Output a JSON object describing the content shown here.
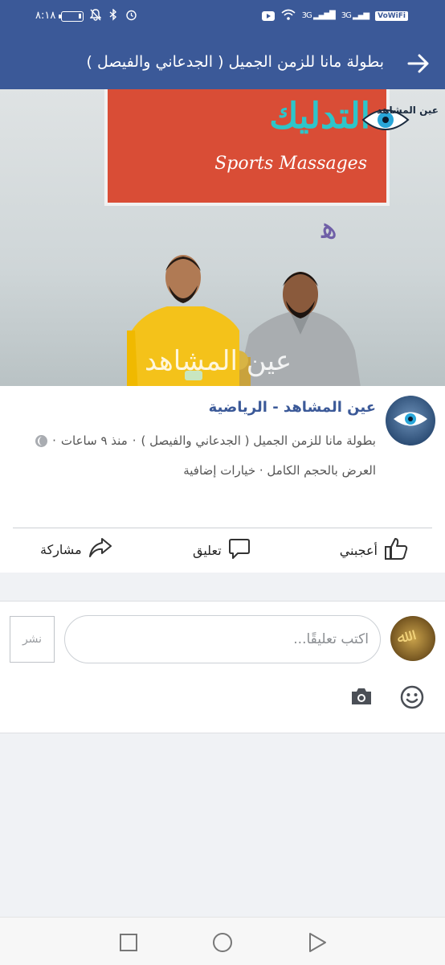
{
  "status_bar": {
    "time": "٨:١٨",
    "network_left": "3G",
    "network_right": "3G",
    "vowifi": "VoWiFi"
  },
  "header": {
    "title": "بطولة مانا للزمن الجميل ( الجدعاني والفيصل )",
    "back_icon": "arrow-right-icon",
    "background": "#3b5998"
  },
  "photo": {
    "banner_title": "التدليك",
    "banner_subtitle": "Sports Massages",
    "logo_text": "عين المشاهد",
    "watermark": "عين المشاهد"
  },
  "post": {
    "page_name": "عين المشاهد - الرياضية",
    "album": "بطولة مانا للزمن الجميل ( الجدعاني والفيصل )",
    "meta_separator": " · ",
    "time_ago": "منذ ٩ ساعات",
    "view_full": "العرض بالحجم الكامل",
    "more_options": "خيارات إضافية",
    "link_color": "#3b5998"
  },
  "actions": {
    "like": "أعجبني",
    "comment": "تعليق",
    "share": "مشاركة"
  },
  "comment_box": {
    "placeholder": "اكتب تعليقًا...",
    "post_button": "نشر"
  }
}
